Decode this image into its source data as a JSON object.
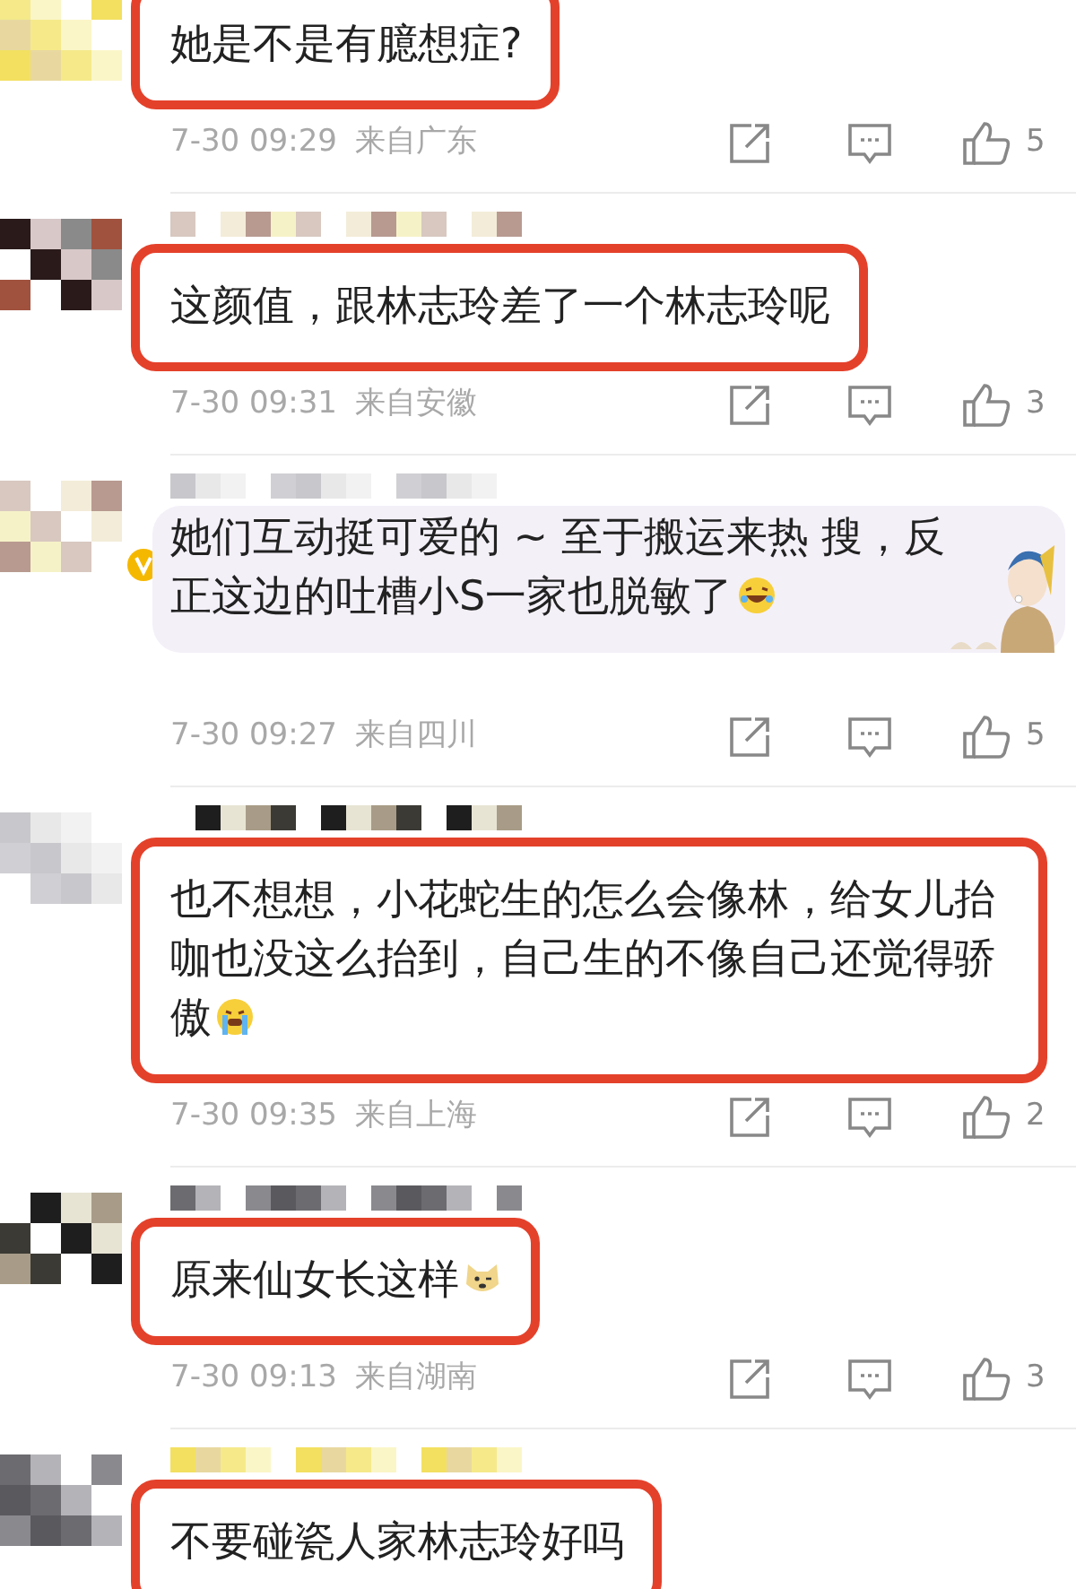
{
  "comments": [
    {
      "kind": "boxed",
      "name_blurred": false,
      "verified": false,
      "text": "她是不是有臆想症?",
      "time": "7-30 09:29",
      "location": "来自广东",
      "likes": "5"
    },
    {
      "kind": "boxed",
      "name_blurred": true,
      "verified": false,
      "text": "这颜值，跟林志玲差了一个林志玲呢",
      "time": "7-30 09:31",
      "location": "来自安徽",
      "likes": "3"
    },
    {
      "kind": "bubble",
      "name_blurred": true,
      "verified": true,
      "text": "她们互动挺可爱的 ~ 至于搬运来热  搜，反正这边的吐槽小S一家也脱敏了",
      "emoji": {
        "kind": "laugh"
      },
      "time": "7-30 09:27",
      "location": "来自四川",
      "likes": "5"
    },
    {
      "kind": "boxed",
      "name_blurred": true,
      "verified": false,
      "text": "也不想想，小花蛇生的怎么会像林，给女儿抬咖也没这么抬到，自己生的不像自己还觉得骄傲",
      "emoji": {
        "kind": "cry"
      },
      "time": "7-30 09:35",
      "location": "来自上海",
      "likes": "2"
    },
    {
      "kind": "boxed",
      "name_blurred": true,
      "verified": false,
      "text": "原来仙女长这样",
      "emoji": {
        "kind": "doge"
      },
      "time": "7-30 09:13",
      "location": "来自湖南",
      "likes": "3"
    },
    {
      "kind": "boxed",
      "name_blurred": true,
      "verified": false,
      "text": "不要碰瓷人家林志玲好吗"
    }
  ]
}
